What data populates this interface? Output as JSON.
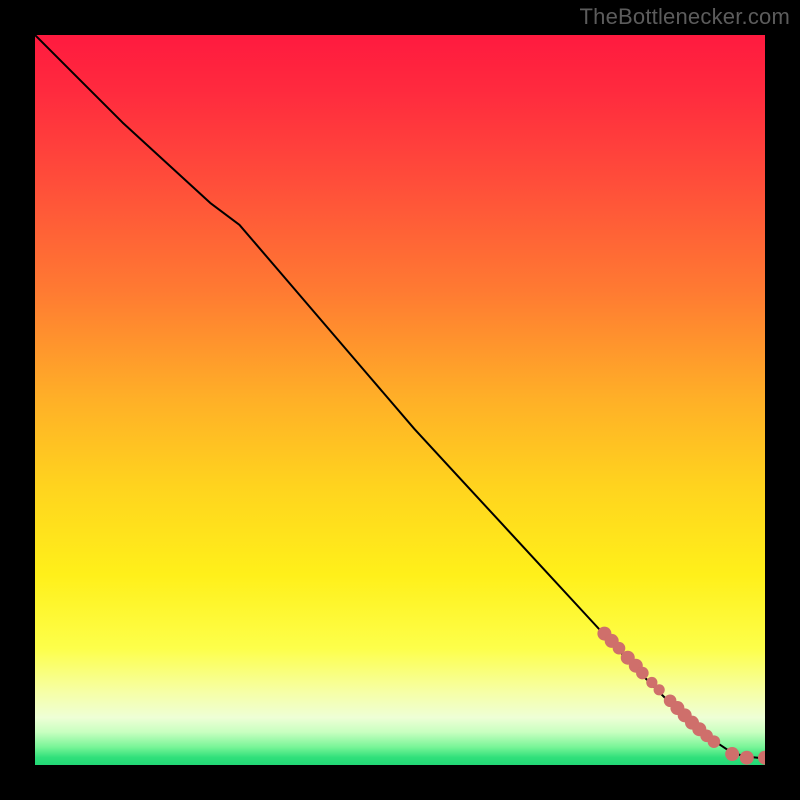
{
  "attribution": "TheBottlenecker.com",
  "colors": {
    "frame": "#000000",
    "attribution_text": "#5c5c5c",
    "line": "#000000",
    "marker_fill": "#cf6f6b",
    "green_band": "#2fe07a"
  },
  "chart_data": {
    "type": "line",
    "title": "",
    "xlabel": "",
    "ylabel": "",
    "xlim": [
      0,
      100
    ],
    "ylim": [
      0,
      100
    ],
    "gradient_stops": [
      {
        "offset": 0.0,
        "color": "#ff1a3f"
      },
      {
        "offset": 0.08,
        "color": "#ff2b3e"
      },
      {
        "offset": 0.2,
        "color": "#ff4d3a"
      },
      {
        "offset": 0.35,
        "color": "#ff7a32"
      },
      {
        "offset": 0.5,
        "color": "#ffb027"
      },
      {
        "offset": 0.62,
        "color": "#ffd41e"
      },
      {
        "offset": 0.74,
        "color": "#fff01a"
      },
      {
        "offset": 0.84,
        "color": "#fdff4a"
      },
      {
        "offset": 0.9,
        "color": "#f6ffa6"
      },
      {
        "offset": 0.935,
        "color": "#eeffd6"
      },
      {
        "offset": 0.955,
        "color": "#c8ffc0"
      },
      {
        "offset": 0.975,
        "color": "#7af598"
      },
      {
        "offset": 0.99,
        "color": "#2fe07a"
      },
      {
        "offset": 1.0,
        "color": "#22d876"
      }
    ],
    "series": [
      {
        "name": "bottleneck-curve",
        "x": [
          0,
          6,
          12,
          18,
          24,
          28,
          34,
          40,
          46,
          52,
          58,
          64,
          70,
          76,
          82,
          88,
          92,
          95,
          97,
          99,
          100
        ],
        "y": [
          100,
          94,
          88,
          82.5,
          77,
          74,
          67,
          60,
          53,
          46,
          39.5,
          33,
          26.5,
          20,
          13.5,
          7.5,
          4,
          2,
          1.2,
          1,
          1
        ]
      }
    ],
    "markers": [
      {
        "x": 78.0,
        "y": 18.0,
        "r": 1.0
      },
      {
        "x": 79.0,
        "y": 17.0,
        "r": 1.0
      },
      {
        "x": 80.0,
        "y": 16.0,
        "r": 0.9
      },
      {
        "x": 81.2,
        "y": 14.7,
        "r": 1.0
      },
      {
        "x": 82.3,
        "y": 13.6,
        "r": 1.0
      },
      {
        "x": 83.2,
        "y": 12.6,
        "r": 0.9
      },
      {
        "x": 84.5,
        "y": 11.3,
        "r": 0.8
      },
      {
        "x": 85.5,
        "y": 10.3,
        "r": 0.8
      },
      {
        "x": 87.0,
        "y": 8.8,
        "r": 0.9
      },
      {
        "x": 88.0,
        "y": 7.8,
        "r": 1.0
      },
      {
        "x": 89.0,
        "y": 6.8,
        "r": 1.0
      },
      {
        "x": 90.0,
        "y": 5.8,
        "r": 1.0
      },
      {
        "x": 91.0,
        "y": 4.9,
        "r": 1.0
      },
      {
        "x": 92.0,
        "y": 4.0,
        "r": 0.9
      },
      {
        "x": 93.0,
        "y": 3.2,
        "r": 0.9
      },
      {
        "x": 95.5,
        "y": 1.5,
        "r": 1.0
      },
      {
        "x": 97.5,
        "y": 1.0,
        "r": 1.0
      },
      {
        "x": 100.0,
        "y": 1.0,
        "r": 1.0
      }
    ]
  }
}
